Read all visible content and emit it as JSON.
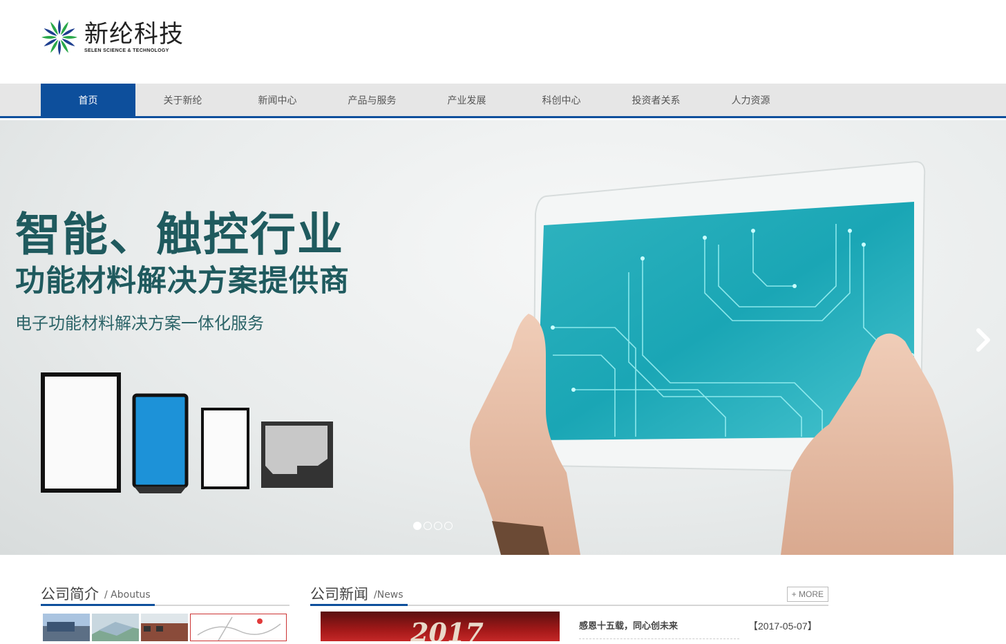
{
  "logo": {
    "name_cn": "新纶科技",
    "name_en": "SELEN SCIENCE & TECHNOLOGY",
    "colors": {
      "blue": "#1e3f8f",
      "green": "#2aa84a"
    }
  },
  "nav": {
    "items": [
      {
        "label": "首页",
        "active": true
      },
      {
        "label": "关于新纶",
        "active": false
      },
      {
        "label": "新闻中心",
        "active": false
      },
      {
        "label": "产品与服务",
        "active": false
      },
      {
        "label": "产业发展",
        "active": false
      },
      {
        "label": "科创中心",
        "active": false
      },
      {
        "label": "投资者关系",
        "active": false
      },
      {
        "label": "人力资源",
        "active": false
      }
    ],
    "accent_color": "#0d4f9c"
  },
  "banner": {
    "headline_1": "智能、触控行业",
    "headline_2": "功能材料解决方案提供商",
    "headline_3": "电子功能材料解决方案一体化服务",
    "next_icon": "chevron-right-icon",
    "slides_count": 4,
    "active_slide": 1
  },
  "about": {
    "title": "公司简介",
    "subtitle": "/ Aboutus"
  },
  "news": {
    "title": "公司新闻",
    "subtitle": "/News",
    "more_label": "+ MORE",
    "image_text": "2017",
    "items": [
      {
        "title": "感恩十五载，同心创未来",
        "date": "【2017-05-07】"
      }
    ]
  }
}
